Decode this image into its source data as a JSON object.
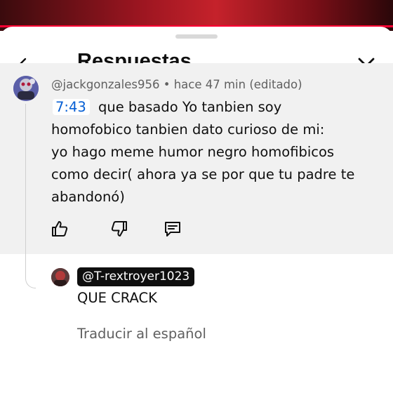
{
  "video": {
    "progress_fraction": 1.0,
    "accent_color": "#ff0033"
  },
  "header": {
    "title": "Respuestas",
    "back_icon": "arrow-left-icon",
    "close_icon": "close-icon"
  },
  "comment": {
    "author": "@jackgonzales956",
    "separator": " • ",
    "time": "hace 47 min (editado)",
    "timestamp": "7:43",
    "lines": [
      "que basado Yo tanbien soy",
      "homofobico tanbien dato curioso de mi:",
      "yo hago meme humor negro homofibicos",
      "como decir( ahora ya se por que tu padre te",
      "abandonó)"
    ],
    "actions": {
      "like_icon": "thumbs-up-icon",
      "dislike_icon": "thumbs-down-icon",
      "reply_icon": "reply-comment-icon"
    },
    "link_color": "#065fd4",
    "panel_color": "#f1f1f1"
  },
  "reply": {
    "mention": "@T-rextroyer1023",
    "text": "QUE CRACK",
    "translate_label": "Traducir al español"
  }
}
